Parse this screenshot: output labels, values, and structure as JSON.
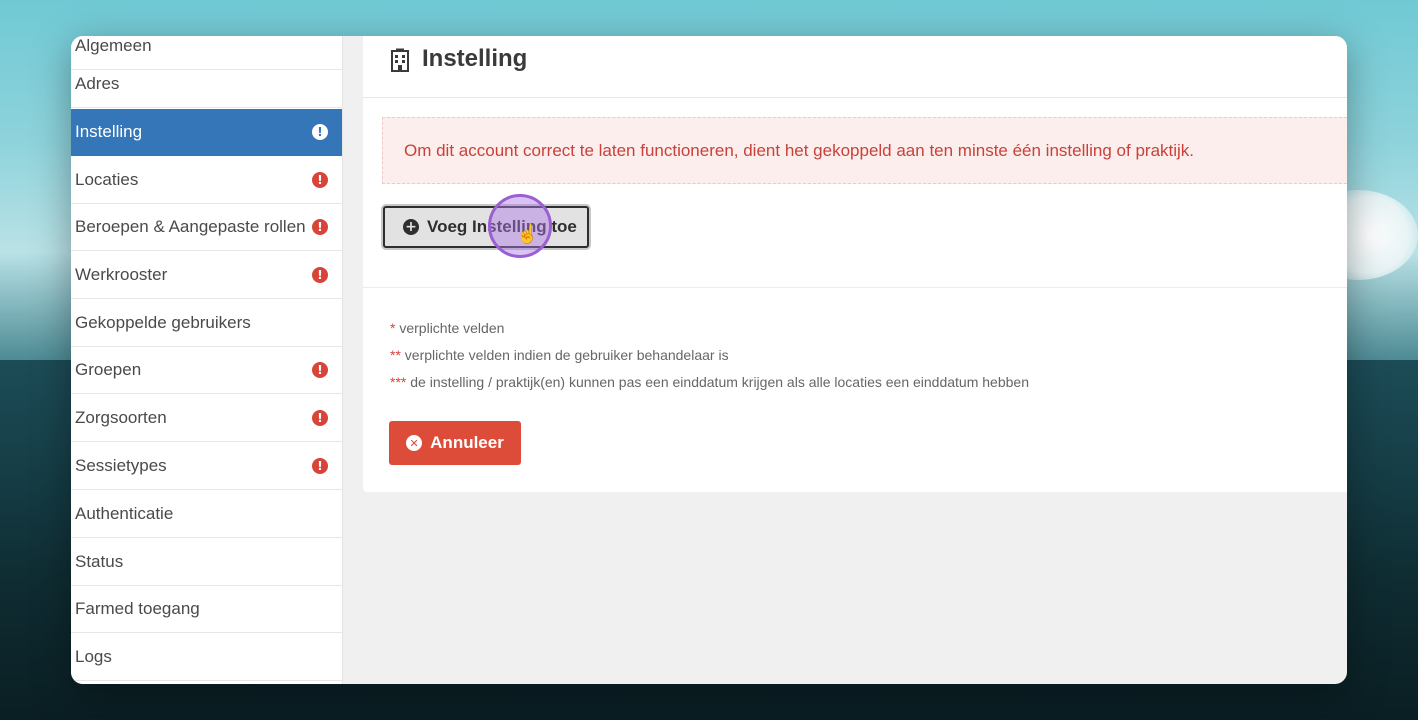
{
  "sidebar": {
    "items": [
      {
        "label": "Algemeen",
        "warning": false
      },
      {
        "label": "Adres",
        "warning": false
      },
      {
        "label": "Instelling",
        "warning": true,
        "active": true
      },
      {
        "label": "Locaties",
        "warning": true
      },
      {
        "label": "Beroepen & Aangepaste rollen",
        "warning": true
      },
      {
        "label": "Werkrooster",
        "warning": true
      },
      {
        "label": "Gekoppelde gebruikers",
        "warning": false
      },
      {
        "label": "Groepen",
        "warning": true
      },
      {
        "label": "Zorgsoorten",
        "warning": true
      },
      {
        "label": "Sessietypes",
        "warning": true
      },
      {
        "label": "Authenticatie",
        "warning": false
      },
      {
        "label": "Status",
        "warning": false
      },
      {
        "label": "Farmed toegang",
        "warning": false
      },
      {
        "label": "Logs",
        "warning": false
      }
    ],
    "warning_glyph": "!"
  },
  "header": {
    "title": "Instelling",
    "icon": "building-icon"
  },
  "alert": {
    "text": "Om dit account correct te laten functioneren, dient het gekoppeld aan ten minste één instelling of praktijk."
  },
  "actions": {
    "add_label": "Voeg Instelling toe",
    "cancel_label": "Annuleer"
  },
  "notes": [
    {
      "marker": "*",
      "text": "verplichte velden"
    },
    {
      "marker": "**",
      "text": "verplichte velden indien de gebruiker behandelaar is"
    },
    {
      "marker": "***",
      "text": "de instelling / praktijk(en) kunnen pas een einddatum krijgen als alle locaties een einddatum hebben"
    }
  ],
  "colors": {
    "active": "#3476b8",
    "danger": "#dd4b39",
    "warning": "#d9443a"
  }
}
